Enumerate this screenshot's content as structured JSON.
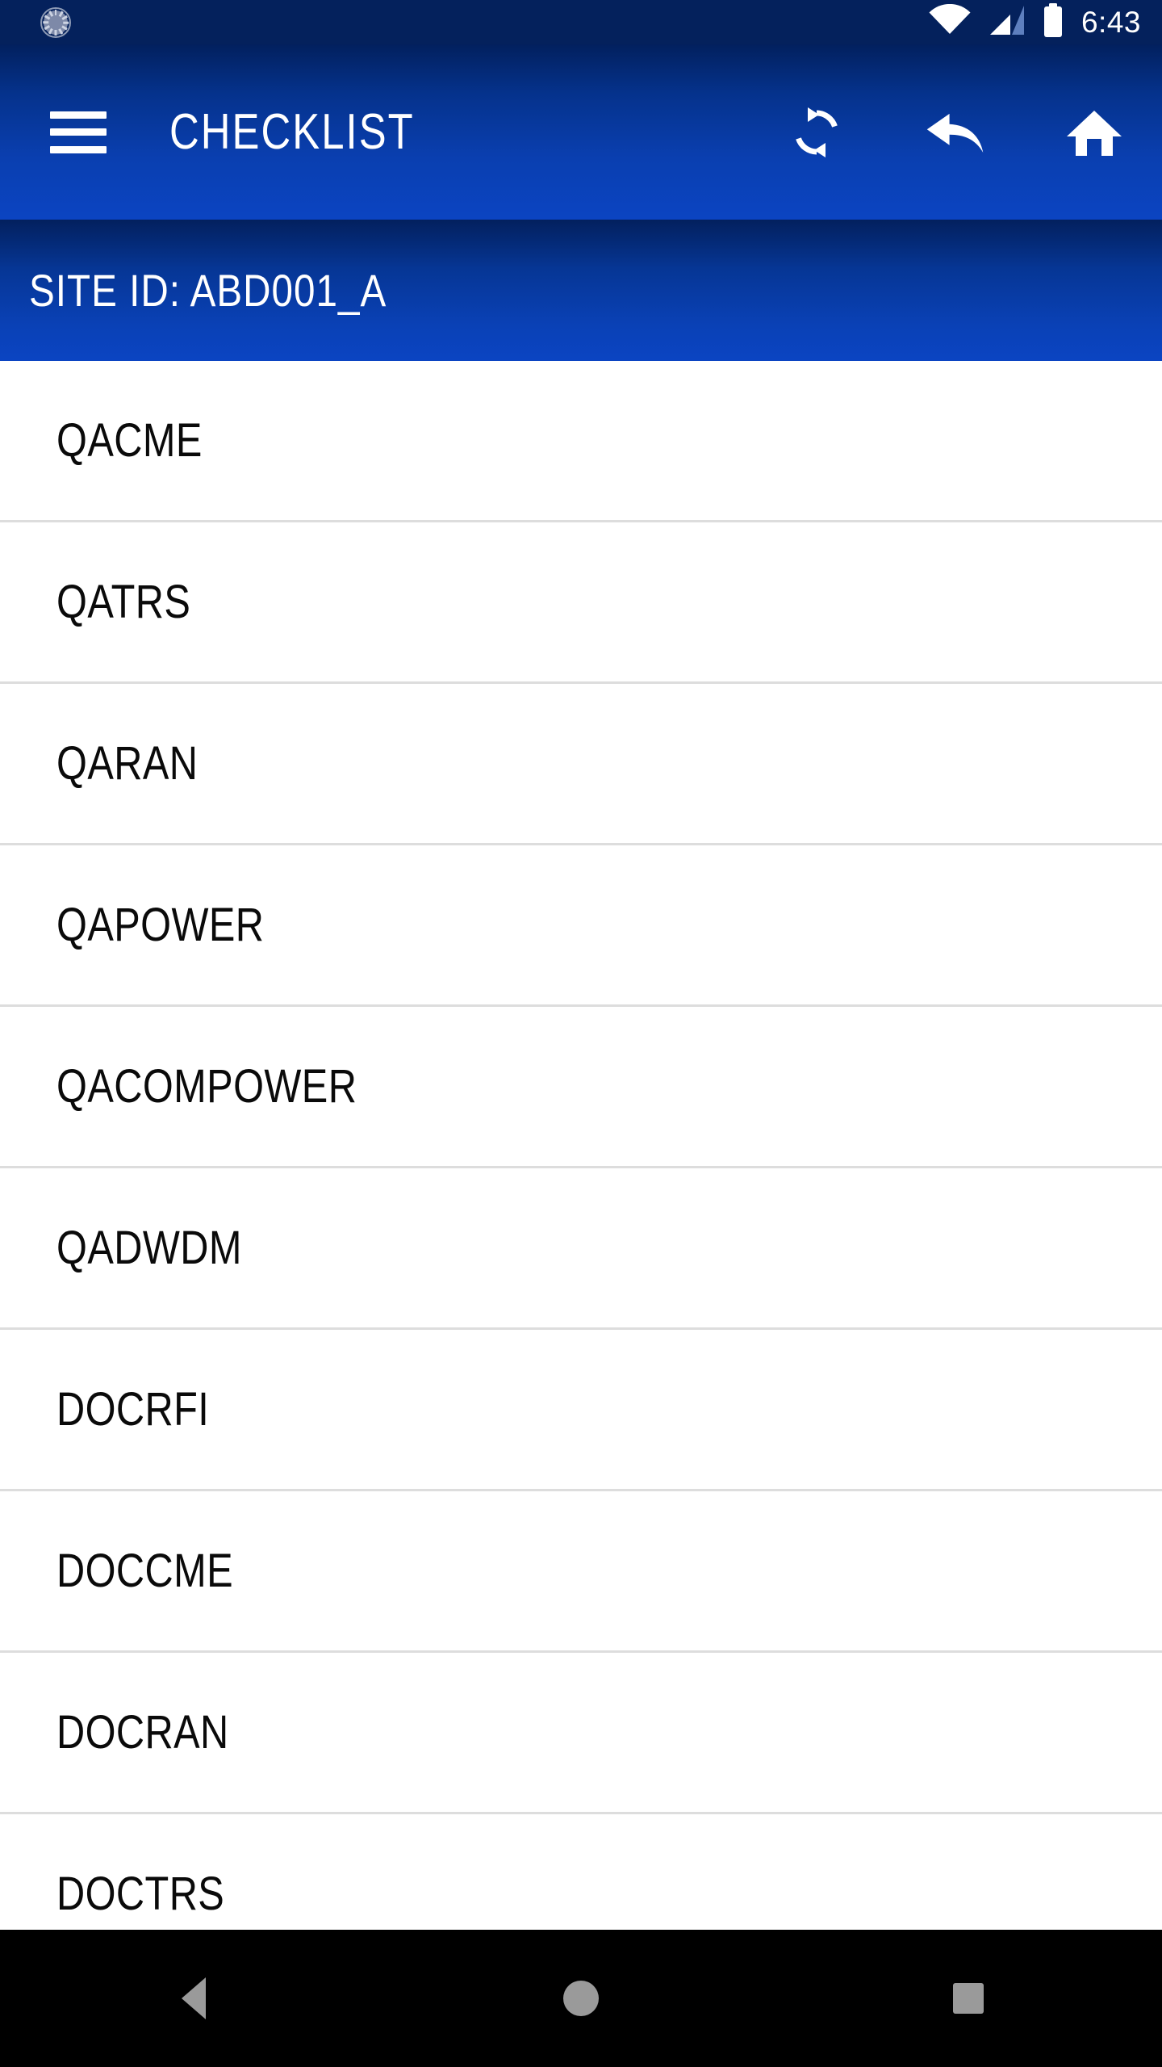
{
  "status_bar": {
    "notification_icon": "sync-progress-icon",
    "wifi_icon": "wifi-icon",
    "signal_icon": "cellular-signal-icon",
    "battery_icon": "battery-full-icon",
    "time": "6:43",
    "background_color": "#04215c"
  },
  "app_bar": {
    "menu_icon": "hamburger-menu-icon",
    "title": "CHECKLIST",
    "gradient_top_color": "#02205e",
    "gradient_bottom_color": "#0b44c2",
    "actions": [
      {
        "name": "sync-icon",
        "label": "Sync"
      },
      {
        "name": "reply-back-icon",
        "label": "Back"
      },
      {
        "name": "home-icon",
        "label": "Home"
      }
    ]
  },
  "site_banner": {
    "label": "SITE ID: ABD001_A",
    "background_top_color": "#03205e",
    "background_bottom_color": "#0b44c2"
  },
  "checklist": {
    "separator_color": "#dddddd",
    "text_color": "#0a0a0a",
    "items": [
      {
        "label": "QACME"
      },
      {
        "label": "QATRS"
      },
      {
        "label": "QARAN"
      },
      {
        "label": "QAPOWER"
      },
      {
        "label": "QACOMPOWER"
      },
      {
        "label": "QADWDM"
      },
      {
        "label": "DOCRFI"
      },
      {
        "label": "DOCCME"
      },
      {
        "label": "DOCRAN"
      },
      {
        "label": "DOCTRS"
      }
    ]
  },
  "nav_bar": {
    "background_color": "#000000",
    "icon_color": "#9a9a9a",
    "buttons": [
      {
        "name": "nav-back-button",
        "label": "Back"
      },
      {
        "name": "nav-home-button",
        "label": "Home"
      },
      {
        "name": "nav-recents-button",
        "label": "Recents"
      }
    ]
  }
}
